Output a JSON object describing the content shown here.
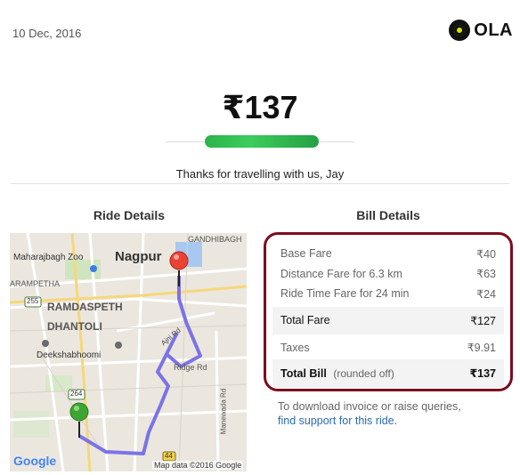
{
  "header": {
    "date": "10 Dec, 2016",
    "brand": "OLA",
    "brand_icon": "ola-logo-icon"
  },
  "summary": {
    "amount": "₹137",
    "thanks": "Thanks for travelling with us, Jay"
  },
  "ride": {
    "title": "Ride Details",
    "map": {
      "labels": {
        "gandhibagh": "GANDHIBAGH",
        "maharajbagh": "Maharajbagh Zoo",
        "nagpur": "Nagpur",
        "aramptha": "ARAMPETHA",
        "ramdaspeth": "RAMDASPETH",
        "dhantoli": "DHANTOLI",
        "deekshabhoomi": "Deekshabhoomi",
        "ajni_rd": "Ajni Rd",
        "ridge_rd": "Ridge Rd",
        "manewada_rd": "Manewada Rd",
        "rd_255": "255",
        "rd_264": "264",
        "rd_44": "44",
        "google": "Google",
        "map_data": "Map data ©2016 Google"
      },
      "colors": {
        "route": "#7b73e6",
        "start_pin": "#3fa532",
        "end_pin": "#e94335"
      }
    }
  },
  "bill": {
    "title": "Bill Details",
    "rows": [
      {
        "label": "Base Fare",
        "value": "₹40"
      },
      {
        "label": "Distance Fare for 6.3 km",
        "value": "₹63"
      },
      {
        "label": "Ride Time Fare for 24 min",
        "value": "₹24"
      }
    ],
    "total_fare": {
      "label": "Total Fare",
      "value": "₹127"
    },
    "taxes": {
      "label": "Taxes",
      "value": "₹9.91"
    },
    "total_bill": {
      "label": "Total Bill",
      "note": "(rounded off)",
      "value": "₹137"
    },
    "border_color": "#7c0c1e"
  },
  "support": {
    "line1": "To download invoice or raise queries,",
    "link": "find support for this ride",
    "tail": "."
  }
}
